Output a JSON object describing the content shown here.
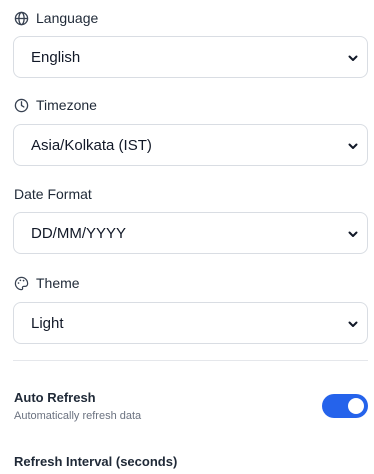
{
  "language": {
    "label": "Language",
    "icon": "globe-icon",
    "selected": "English"
  },
  "timezone": {
    "label": "Timezone",
    "icon": "clock-icon",
    "selected": "Asia/Kolkata (IST)"
  },
  "date_format": {
    "label": "Date Format",
    "selected": "DD/MM/YYYY"
  },
  "theme": {
    "label": "Theme",
    "icon": "palette-icon",
    "selected": "Light"
  },
  "auto_refresh": {
    "title": "Auto Refresh",
    "description": "Automatically refresh data",
    "enabled": true
  },
  "refresh_interval": {
    "label": "Refresh Interval (seconds)"
  },
  "colors": {
    "accent": "#2563eb"
  }
}
